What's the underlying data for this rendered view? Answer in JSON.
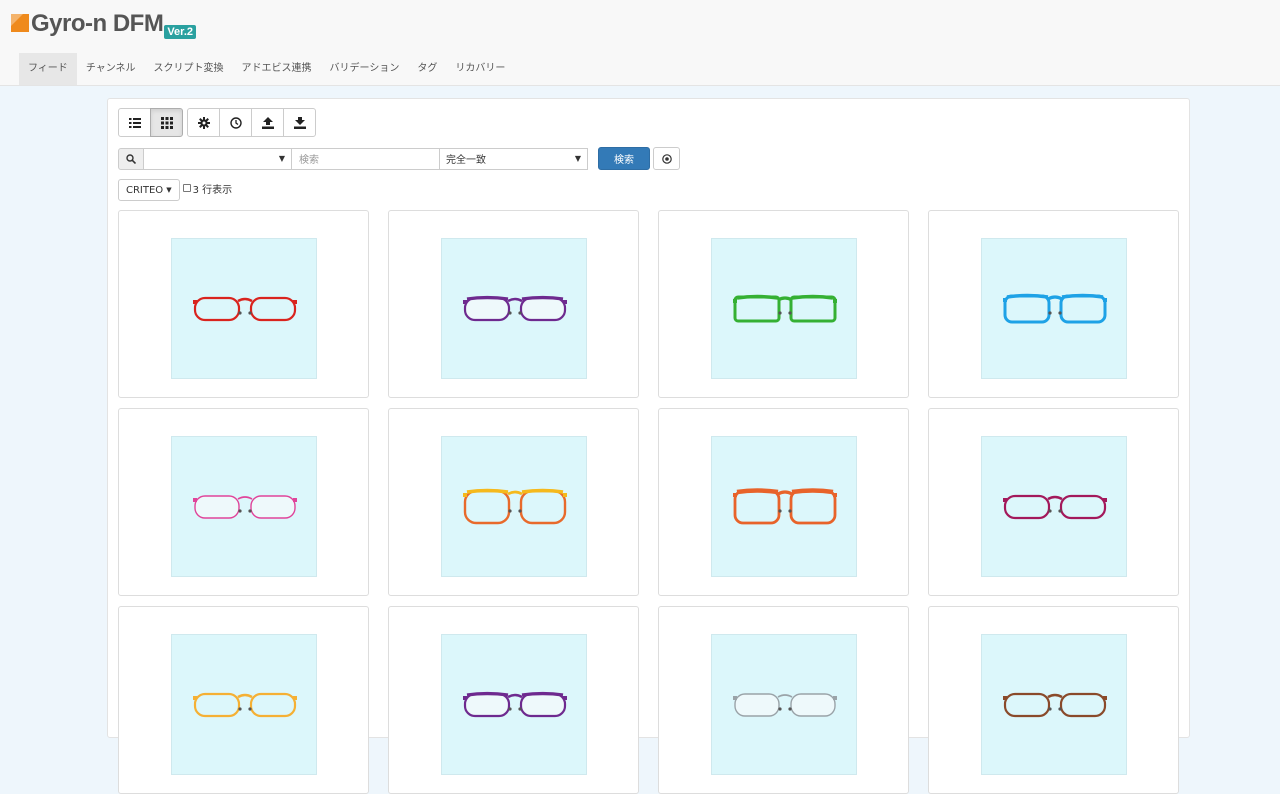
{
  "logo": {
    "name": "Gyro-n DFM",
    "version": "Ver.2",
    "mark_color": "#ef8a1c",
    "version_color": "#2aa1a0"
  },
  "nav": {
    "tabs": [
      {
        "label": "フィード",
        "active": true
      },
      {
        "label": "チャンネル"
      },
      {
        "label": "スクリプト変換"
      },
      {
        "label": "アドエビス連携"
      },
      {
        "label": "バリデーション"
      },
      {
        "label": "タグ"
      },
      {
        "label": "リカバリー"
      }
    ]
  },
  "toolbar": {
    "view_buttons": [
      {
        "icon": "list-view-icon",
        "active": false
      },
      {
        "icon": "grid-view-icon",
        "active": true
      }
    ],
    "action_buttons": [
      {
        "icon": "gear-icon"
      },
      {
        "icon": "history-clock-icon"
      },
      {
        "icon": "upload-icon"
      },
      {
        "icon": "download-icon"
      }
    ]
  },
  "search": {
    "field_select_value": "",
    "keyword_placeholder": "検索",
    "match_select_value": "完全一致",
    "submit_label": "検索"
  },
  "options": {
    "channel_dropdown_label": "CRITEO",
    "three_line_label": "3 行表示",
    "three_line_checked": false
  },
  "accent_color": "#337ab7",
  "products": [
    {
      "frame_color": "#d9241e",
      "style": "oval"
    },
    {
      "frame_color": "#6e2a8f",
      "style": "browline"
    },
    {
      "frame_color": "#35b033",
      "style": "rect"
    },
    {
      "frame_color": "#1ea2e6",
      "style": "wellington"
    },
    {
      "frame_color": "#e0449a",
      "style": "thin-oval"
    },
    {
      "frame_color": "#f5b91c",
      "style": "round-gradient",
      "frame_color2": "#e86a2b"
    },
    {
      "frame_color": "#e8632a",
      "style": "cat"
    },
    {
      "frame_color": "#a3195b",
      "style": "oval"
    },
    {
      "frame_color": "#f5b034",
      "style": "oval"
    },
    {
      "frame_color": "#6e2a8f",
      "style": "browline"
    },
    {
      "frame_color": "#9aa3a8",
      "style": "thin-oval"
    },
    {
      "frame_color": "#8a4a2a",
      "style": "oval"
    }
  ]
}
